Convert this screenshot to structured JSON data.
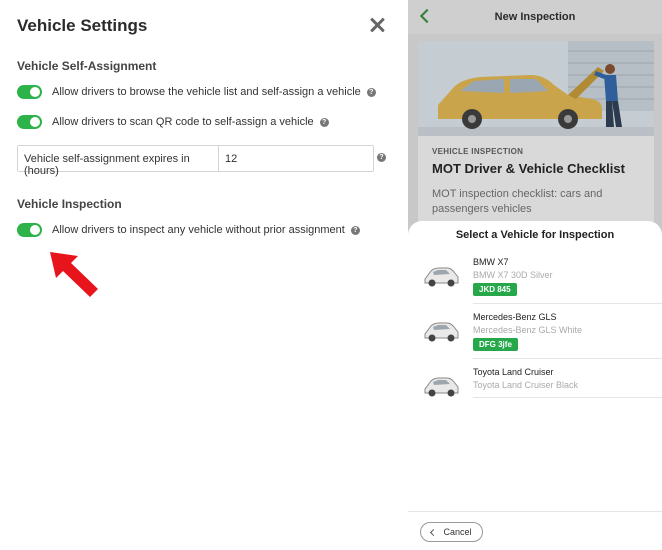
{
  "settings": {
    "title": "Vehicle Settings",
    "self_assignment_heading": "Vehicle Self-Assignment",
    "browse_label": "Allow drivers to browse the vehicle list and self-assign a vehicle",
    "qr_label": "Allow drivers to scan QR code to self-assign a vehicle",
    "expires_label": "Vehicle self-assignment expires in (hours)",
    "expires_value": "12",
    "inspection_heading": "Vehicle Inspection",
    "inspect_label": "Allow drivers to inspect any vehicle without prior assignment",
    "toggles_on": true,
    "toggle_color": "#2db34a",
    "annotation_color": "#e8141b"
  },
  "phone": {
    "header_title": "New Inspection",
    "card": {
      "category": "VEHICLE INSPECTION",
      "title": "MOT Driver & Vehicle Checklist",
      "description": "MOT inspection checklist: cars and passengers vehicles"
    },
    "sheet": {
      "title": "Select a Vehicle for Inspection",
      "vehicles": [
        {
          "name": "BMW X7",
          "model": "BMW X7 30D Silver",
          "plate": "JKD 845"
        },
        {
          "name": "Mercedes-Benz GLS",
          "model": "Mercedes-Benz GLS White",
          "plate": "DFG 3jfe"
        },
        {
          "name": "Toyota Land Cruiser",
          "model": "Toyota Land Cruiser Black"
        }
      ],
      "cancel_label": "Cancel"
    }
  }
}
